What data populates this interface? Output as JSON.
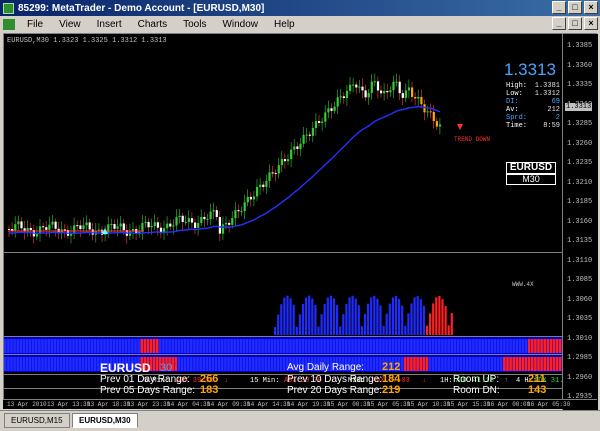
{
  "window": {
    "title": "85299: MetaTrader - Demo Account - [EURUSD,M30]",
    "minimize": "_",
    "maximize": "□",
    "close": "×"
  },
  "menu": [
    "File",
    "View",
    "Insert",
    "Charts",
    "Tools",
    "Window",
    "Help"
  ],
  "chart_header": "EURUSD,M30  1.3323 1.3325 1.3312 1.3313",
  "price_axis": [
    "1.3385",
    "1.3360",
    "1.3335",
    "1.3310",
    "1.3285",
    "1.3260",
    "1.3235",
    "1.3210",
    "1.3185",
    "1.3160",
    "1.3135",
    "1.3110",
    "1.3085",
    "1.3060",
    "1.3035",
    "1.3010",
    "1.2985",
    "1.2960",
    "1.2935"
  ],
  "current_price_box": "1.3313",
  "info": {
    "price": "1.3313",
    "rows": [
      {
        "k": "High:",
        "v": "1.3381"
      },
      {
        "k": "Low:",
        "v": "1.3312"
      },
      {
        "k": "DI:",
        "v": "69"
      },
      {
        "k": "Av:",
        "v": "212"
      },
      {
        "k": "Sprd:",
        "v": "2"
      },
      {
        "k": "Time:",
        "v": "8:59"
      }
    ],
    "symbol": "EURUSD",
    "timeframe": "M30"
  },
  "trend_label": "TREND DOWN",
  "watermark": "WWW.4X",
  "adx": [
    {
      "tf": "5 Min:",
      "val": "ADX 39.31",
      "dir": "down",
      "arrow": "↓"
    },
    {
      "tf": "15 Min:",
      "val": "ADX 30.70",
      "dir": "down",
      "arrow": "↓"
    },
    {
      "tf": "M30:",
      "val": "ADX 27.03",
      "dir": "down",
      "arrow": "↓"
    },
    {
      "tf": "1H:",
      "val": "ADX 41.13",
      "dir": "up",
      "arrow": "↑"
    },
    {
      "tf": "4 Hr:",
      "val": "ADX 31.52",
      "dir": "up",
      "arrow": "↑"
    }
  ],
  "adr": {
    "symbol": "EURUSD",
    "spread": "30",
    "prev01_label": "Prev 01 Day Range:",
    "prev01": "266",
    "prev05_label": "Prev 05 Days Range:",
    "prev05": "183",
    "avg_label": "Avg Daily Range:",
    "avg": "212",
    "prev10_label": "Prev 10 Days Range:",
    "prev10": "184",
    "prev20_label": "Prev 20 Days Range:",
    "prev20": "219",
    "roomup_label": "Room UP:",
    "roomup": "211",
    "roomdn_label": "Room DN:",
    "roomdn": "143"
  },
  "time_axis": [
    "13 Apr 2010",
    "13 Apr 13:30",
    "13 Apr 18:30",
    "13 Apr 23:30",
    "14 Apr 04:30",
    "14 Apr 09:30",
    "14 Apr 14:30",
    "14 Apr 19:30",
    "15 Apr 00:30",
    "15 Apr 05:30",
    "15 Apr 10:30",
    "15 Apr 15:30",
    "16 Apr 00:00",
    "16 Apr 05:30"
  ],
  "tabs": [
    {
      "label": "EURUSD,M15",
      "active": false
    },
    {
      "label": "EURUSD,M30",
      "active": true
    }
  ],
  "colors": {
    "bull": "#33cc33",
    "bear": "#ff4040",
    "ma": "#2233ff",
    "accent": "#4aa3ff",
    "orange": "#ffa500"
  }
}
